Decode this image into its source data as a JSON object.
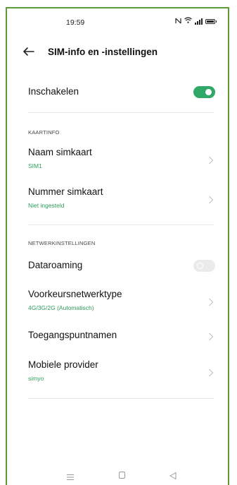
{
  "status_bar": {
    "time": "19:59",
    "icons": [
      "nfc-icon",
      "wifi-icon",
      "signal-icon",
      "battery-icon"
    ]
  },
  "header": {
    "back_icon": "arrow-left-icon",
    "title": "SIM-info en -instellingen"
  },
  "enable_row": {
    "label": "Inschakelen",
    "toggle_on": true
  },
  "card_info": {
    "section_title": "KAARTINFO",
    "sim_name": {
      "label": "Naam simkaart",
      "value": "SIM1"
    },
    "sim_number": {
      "label": "Nummer simkaart",
      "value": "Niet ingesteld"
    }
  },
  "network_settings": {
    "section_title": "NETWERKINSTELLINGEN",
    "data_roaming": {
      "label": "Dataroaming",
      "toggle_on": false
    },
    "preferred_network": {
      "label": "Voorkeursnetwerktype",
      "value": "4G/3G/2G (Automatisch)"
    },
    "apn": {
      "label": "Toegangspuntnamen"
    },
    "mobile_provider": {
      "label": "Mobiele provider",
      "value": "simyo"
    }
  },
  "colors": {
    "accent": "#2fa86a",
    "frame_border": "#5c9a3a",
    "toggle_off": "#ebebeb"
  },
  "nav_bar": {
    "icons": [
      "menu-icon",
      "home-icon",
      "back-triangle-icon"
    ]
  }
}
